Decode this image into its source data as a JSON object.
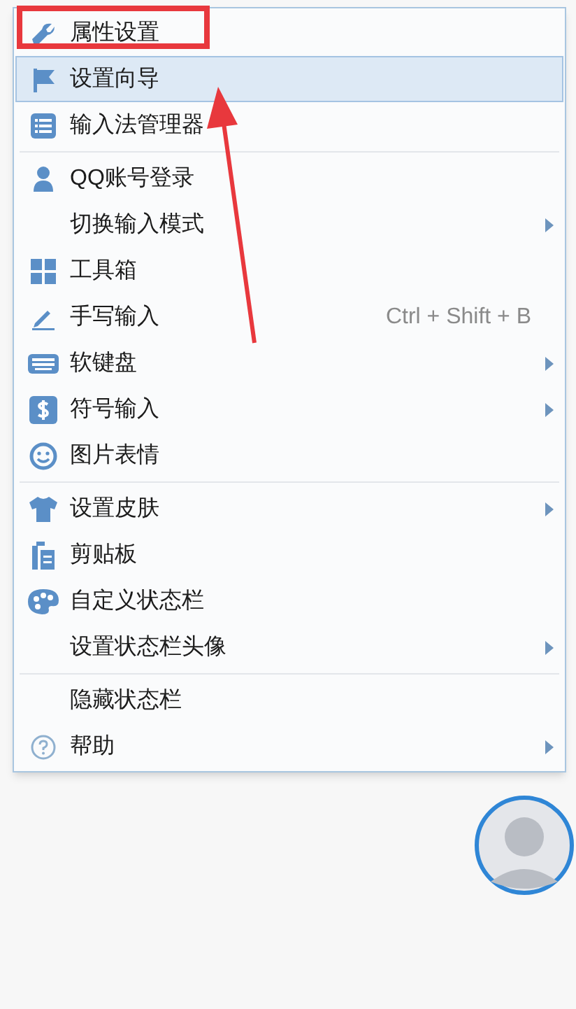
{
  "menu": {
    "groups": [
      {
        "items": [
          {
            "label": "属性设置",
            "selected": false,
            "submenu": false
          },
          {
            "label": "设置向导",
            "selected": true,
            "submenu": false
          },
          {
            "label": "输入法管理器",
            "selected": false,
            "submenu": false
          }
        ]
      },
      {
        "items": [
          {
            "label": "QQ账号登录",
            "selected": false,
            "submenu": false
          },
          {
            "label": "切换输入模式",
            "selected": false,
            "submenu": true
          },
          {
            "label": "工具箱",
            "selected": false,
            "submenu": false
          },
          {
            "label": "手写输入",
            "selected": false,
            "submenu": false,
            "shortcut": "Ctrl + Shift + B"
          },
          {
            "label": "软键盘",
            "selected": false,
            "submenu": true
          },
          {
            "label": "符号输入",
            "selected": false,
            "submenu": true
          },
          {
            "label": "图片表情",
            "selected": false,
            "submenu": false
          }
        ]
      },
      {
        "items": [
          {
            "label": "设置皮肤",
            "selected": false,
            "submenu": true
          },
          {
            "label": "剪贴板",
            "selected": false,
            "submenu": false
          },
          {
            "label": "自定义状态栏",
            "selected": false,
            "submenu": false
          },
          {
            "label": "设置状态栏头像",
            "selected": false,
            "submenu": true
          }
        ]
      },
      {
        "items": [
          {
            "label": "隐藏状态栏",
            "selected": false,
            "submenu": false
          },
          {
            "label": "帮助",
            "selected": false,
            "submenu": true
          }
        ]
      }
    ]
  }
}
